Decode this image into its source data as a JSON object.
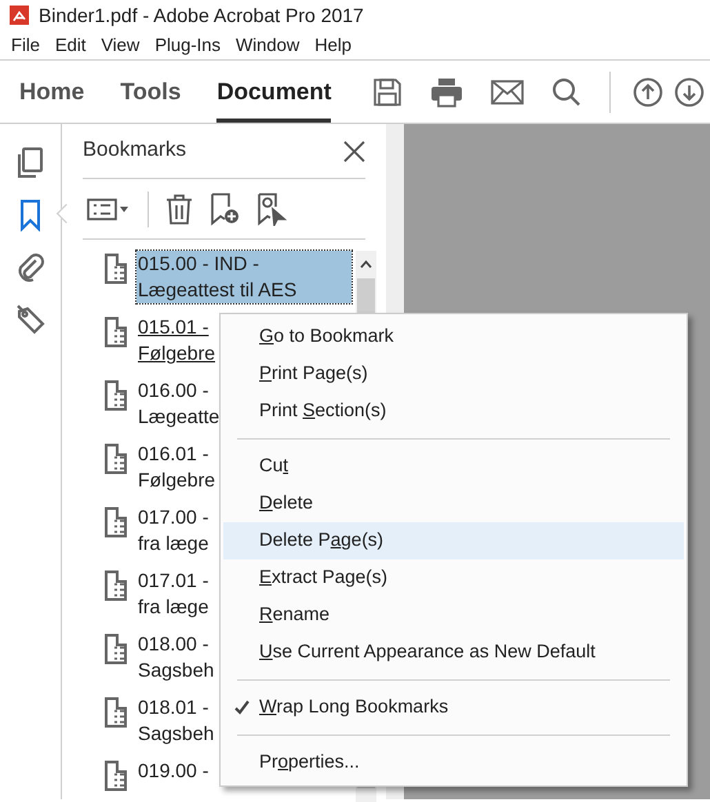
{
  "window": {
    "title": "Binder1.pdf - Adobe Acrobat Pro 2017"
  },
  "menu_bar": [
    "File",
    "Edit",
    "View",
    "Plug-Ins",
    "Window",
    "Help"
  ],
  "tabs": [
    {
      "label": "Home",
      "selected": false
    },
    {
      "label": "Tools",
      "selected": false
    },
    {
      "label": "Document",
      "selected": true
    }
  ],
  "side_rail": [
    {
      "kind": "pages",
      "selected": false
    },
    {
      "kind": "bookmarks",
      "selected": true
    },
    {
      "kind": "attachments",
      "selected": false
    },
    {
      "kind": "tags",
      "selected": false
    }
  ],
  "bookmarks_panel": {
    "title": "Bookmarks",
    "items": [
      {
        "lines": [
          "015.00 - IND -",
          "Lægeattest til AES"
        ],
        "selected": true,
        "hovered": false
      },
      {
        "lines": [
          "015.01 -",
          "Følgebre"
        ],
        "selected": false,
        "hovered": true
      },
      {
        "lines": [
          "016.00 -",
          "Lægeatte"
        ],
        "selected": false,
        "hovered": false
      },
      {
        "lines": [
          "016.01 -",
          "Følgebre"
        ],
        "selected": false,
        "hovered": false
      },
      {
        "lines": [
          "017.00 -",
          "fra læge"
        ],
        "selected": false,
        "hovered": false
      },
      {
        "lines": [
          "017.01 -",
          "fra læge"
        ],
        "selected": false,
        "hovered": false
      },
      {
        "lines": [
          "018.00 -",
          "Sagsbeh"
        ],
        "selected": false,
        "hovered": false
      },
      {
        "lines": [
          "018.01 -",
          "Sagsbeh"
        ],
        "selected": false,
        "hovered": false
      },
      {
        "lines": [
          "019.00 -"
        ],
        "selected": false,
        "hovered": false
      }
    ]
  },
  "context_menu": [
    {
      "kind": "item",
      "key": "G",
      "after": "o to Bookmark",
      "checked": false,
      "selected": false
    },
    {
      "kind": "item",
      "key": "P",
      "after": "rint Page(s)",
      "checked": false,
      "selected": false
    },
    {
      "kind": "item",
      "before": "Print ",
      "key": "S",
      "after": "ection(s)",
      "checked": false,
      "selected": false
    },
    {
      "kind": "separator"
    },
    {
      "kind": "item",
      "before": "Cu",
      "key": "t",
      "checked": false,
      "selected": false
    },
    {
      "kind": "item",
      "key": "D",
      "after": "elete",
      "checked": false,
      "selected": false
    },
    {
      "kind": "item",
      "before": "Delete P",
      "key": "a",
      "after": "ge(s)",
      "checked": false,
      "selected": true
    },
    {
      "kind": "item",
      "key": "E",
      "after": "xtract Page(s)",
      "checked": false,
      "selected": false
    },
    {
      "kind": "item",
      "key": "R",
      "after": "ename",
      "checked": false,
      "selected": false
    },
    {
      "kind": "item",
      "key": "U",
      "after": "se Current Appearance as New Default",
      "checked": false,
      "selected": false
    },
    {
      "kind": "separator"
    },
    {
      "kind": "item",
      "key": "W",
      "after": "rap Long Bookmarks",
      "checked": true,
      "selected": false
    },
    {
      "kind": "separator"
    },
    {
      "kind": "item",
      "before": "Pr",
      "key": "o",
      "after": "perties...",
      "checked": false,
      "selected": false
    }
  ]
}
